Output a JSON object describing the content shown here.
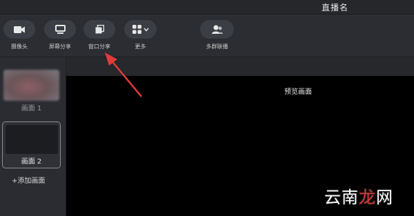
{
  "window": {
    "title": "直播名"
  },
  "toolbar": {
    "items": [
      {
        "label": "摄像头",
        "icon": "camera-icon"
      },
      {
        "label": "屏幕分享",
        "icon": "monitor-icon"
      },
      {
        "label": "窗口分享",
        "icon": "window-share-icon"
      },
      {
        "label": "更多",
        "icon": "grid-icon"
      },
      {
        "label": "多群联播",
        "icon": "multi-user-icon"
      }
    ]
  },
  "sidebar": {
    "scenes": [
      {
        "label": "画面 1"
      },
      {
        "label": "画面 2"
      }
    ],
    "add_label": "+添加画面"
  },
  "preview": {
    "label": "预览画面"
  },
  "watermark": {
    "prefix": "云南",
    "highlight": "龙",
    "suffix": "网"
  },
  "colors": {
    "annotation_arrow": "#e23b3b",
    "accent": "#d83a3a"
  }
}
